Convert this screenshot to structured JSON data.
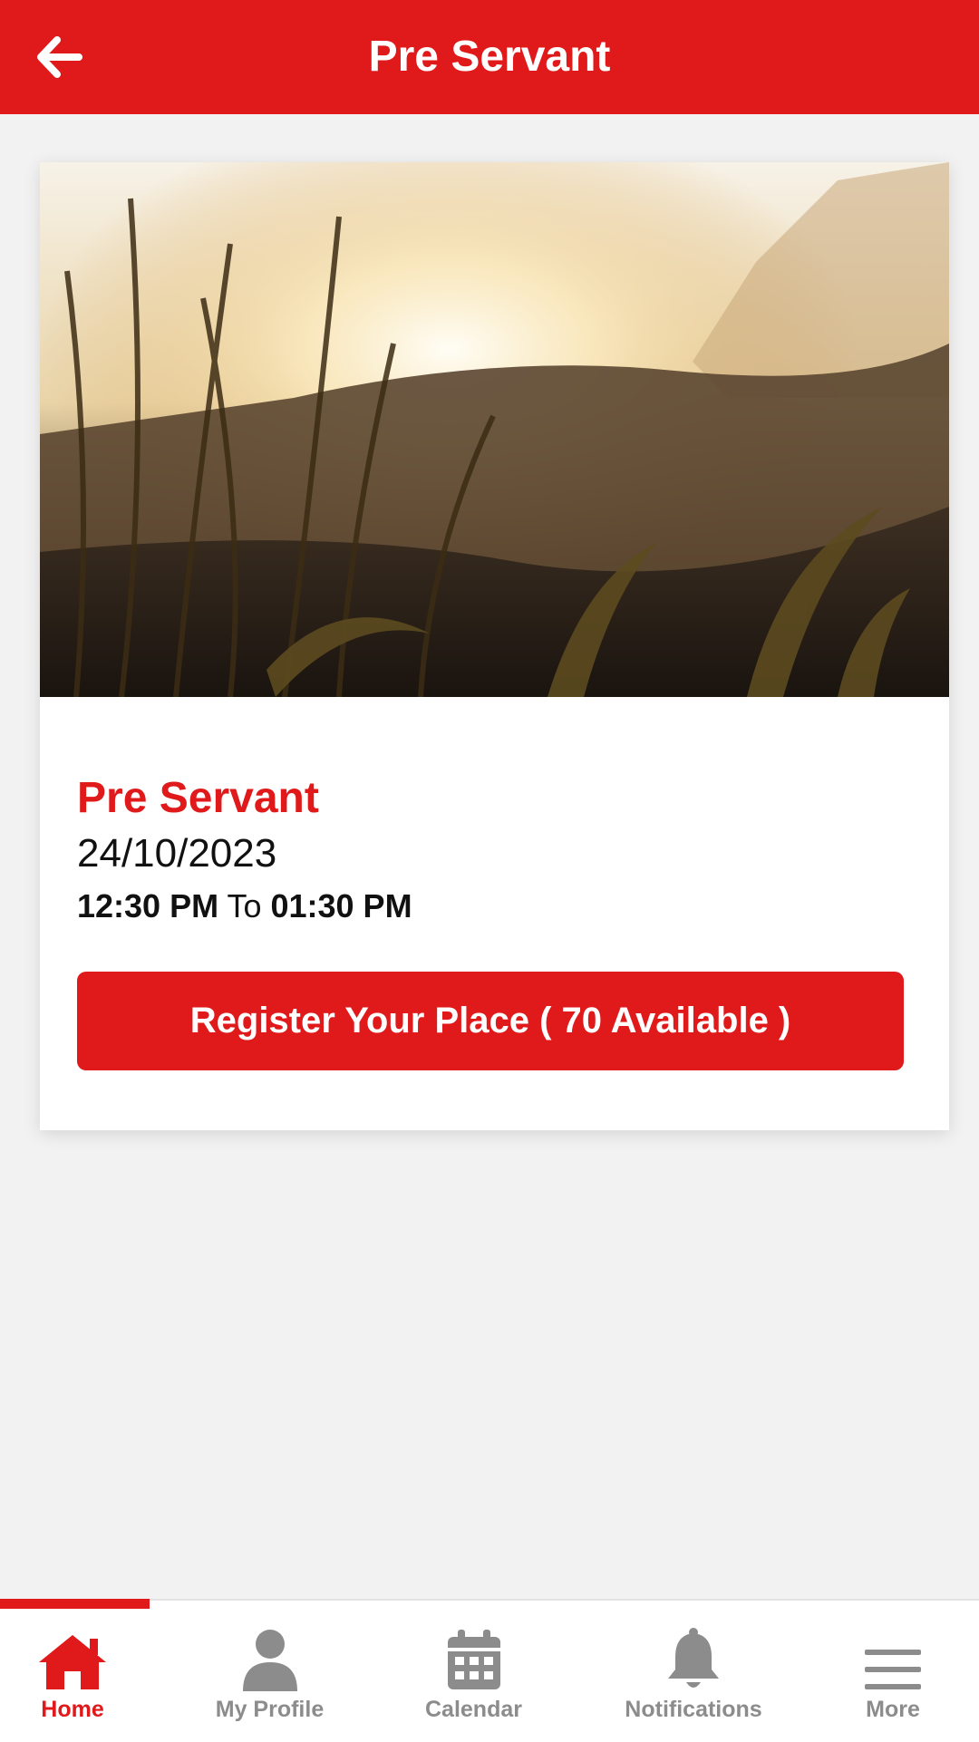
{
  "header": {
    "title": "Pre Servant"
  },
  "event": {
    "title": "Pre Servant",
    "date": "24/10/2023",
    "start_time": "12:30 PM",
    "time_separator": "To",
    "end_time": "01:30 PM",
    "register_label": "Register Your Place ( 70 Available )"
  },
  "tabs": [
    {
      "label": "Home",
      "icon": "home-icon",
      "active": true
    },
    {
      "label": "My Profile",
      "icon": "person-icon",
      "active": false
    },
    {
      "label": "Calendar",
      "icon": "calendar-icon",
      "active": false
    },
    {
      "label": "Notifications",
      "icon": "bell-icon",
      "active": false
    },
    {
      "label": "More",
      "icon": "menu-icon",
      "active": false
    }
  ],
  "colors": {
    "brand": "#e0191b",
    "inactive": "#8c8c8c",
    "background": "#f2f2f2"
  }
}
